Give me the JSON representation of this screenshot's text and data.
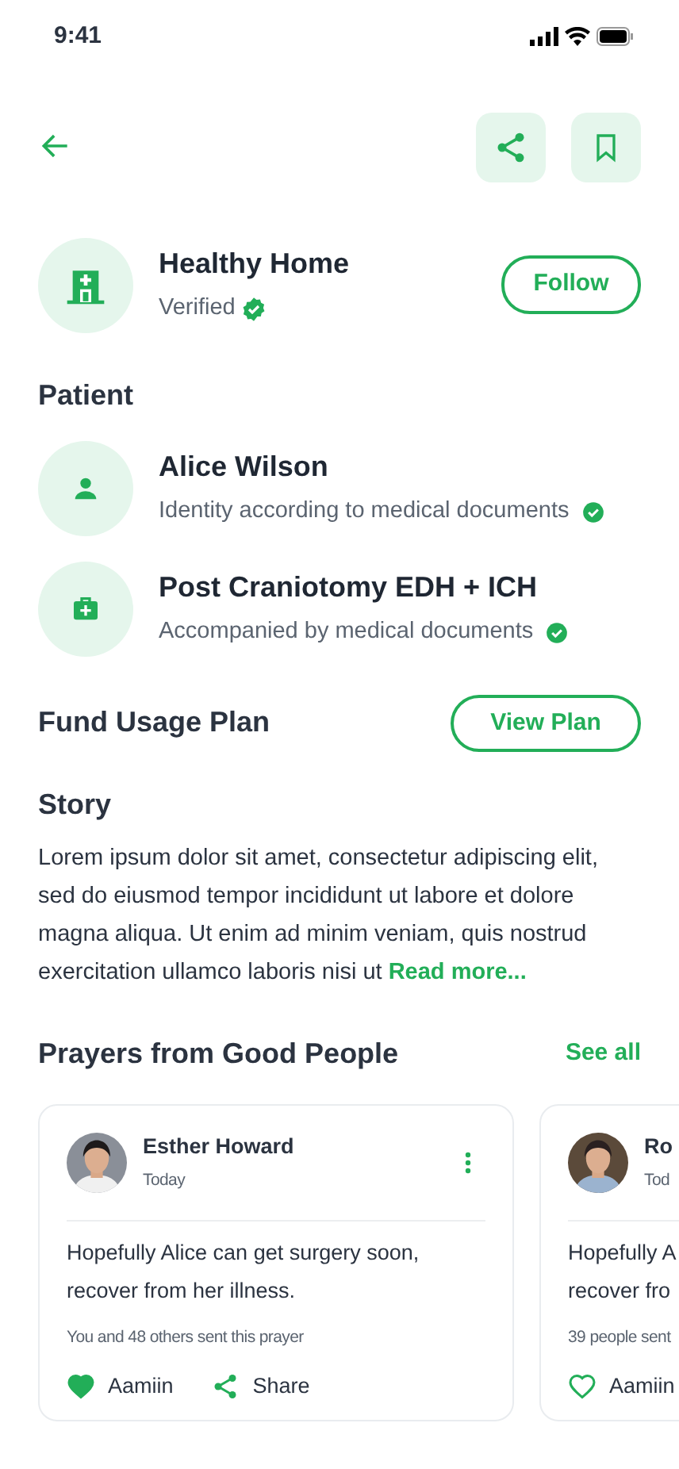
{
  "status_bar": {
    "time": "9:41"
  },
  "organization": {
    "name": "Healthy Home",
    "status": "Verified",
    "verified": true,
    "follow_label": "Follow"
  },
  "patient": {
    "heading": "Patient",
    "items": [
      {
        "kind": "person",
        "title": "Alice Wilson",
        "subtitle": "Identity according to medical documents",
        "verified": true
      },
      {
        "kind": "medical",
        "title": "Post Craniotomy EDH + ICH",
        "subtitle": "Accompanied by medical documents",
        "verified": true
      }
    ]
  },
  "fund_usage": {
    "heading": "Fund Usage Plan",
    "button": "View Plan"
  },
  "story": {
    "heading": "Story",
    "text": "Lorem ipsum dolor sit amet, consectetur adipiscing elit, sed do eiusmod tempor incididunt ut labore et dolore magna aliqua. Ut enim ad minim veniam, quis nostrud exercitation ullamco laboris nisi ut",
    "more": "Read more..."
  },
  "prayers": {
    "heading": "Prayers from Good People",
    "see_all": "See all",
    "cards": [
      {
        "name": "Esther Howard",
        "date": "Today",
        "message": "Hopefully Alice can get surgery soon, recover from her illness.",
        "count_text": "You and 48 others sent this prayer",
        "amen_label": "Aamiin",
        "liked": true,
        "share_label": "Share",
        "menu": true
      },
      {
        "name": "Ro",
        "date": "Tod",
        "message_lines": [
          "Hopefully A",
          "recover fro"
        ],
        "count_text": "39 people sent",
        "amen_label": "Aamiin",
        "liked": false
      }
    ]
  }
}
